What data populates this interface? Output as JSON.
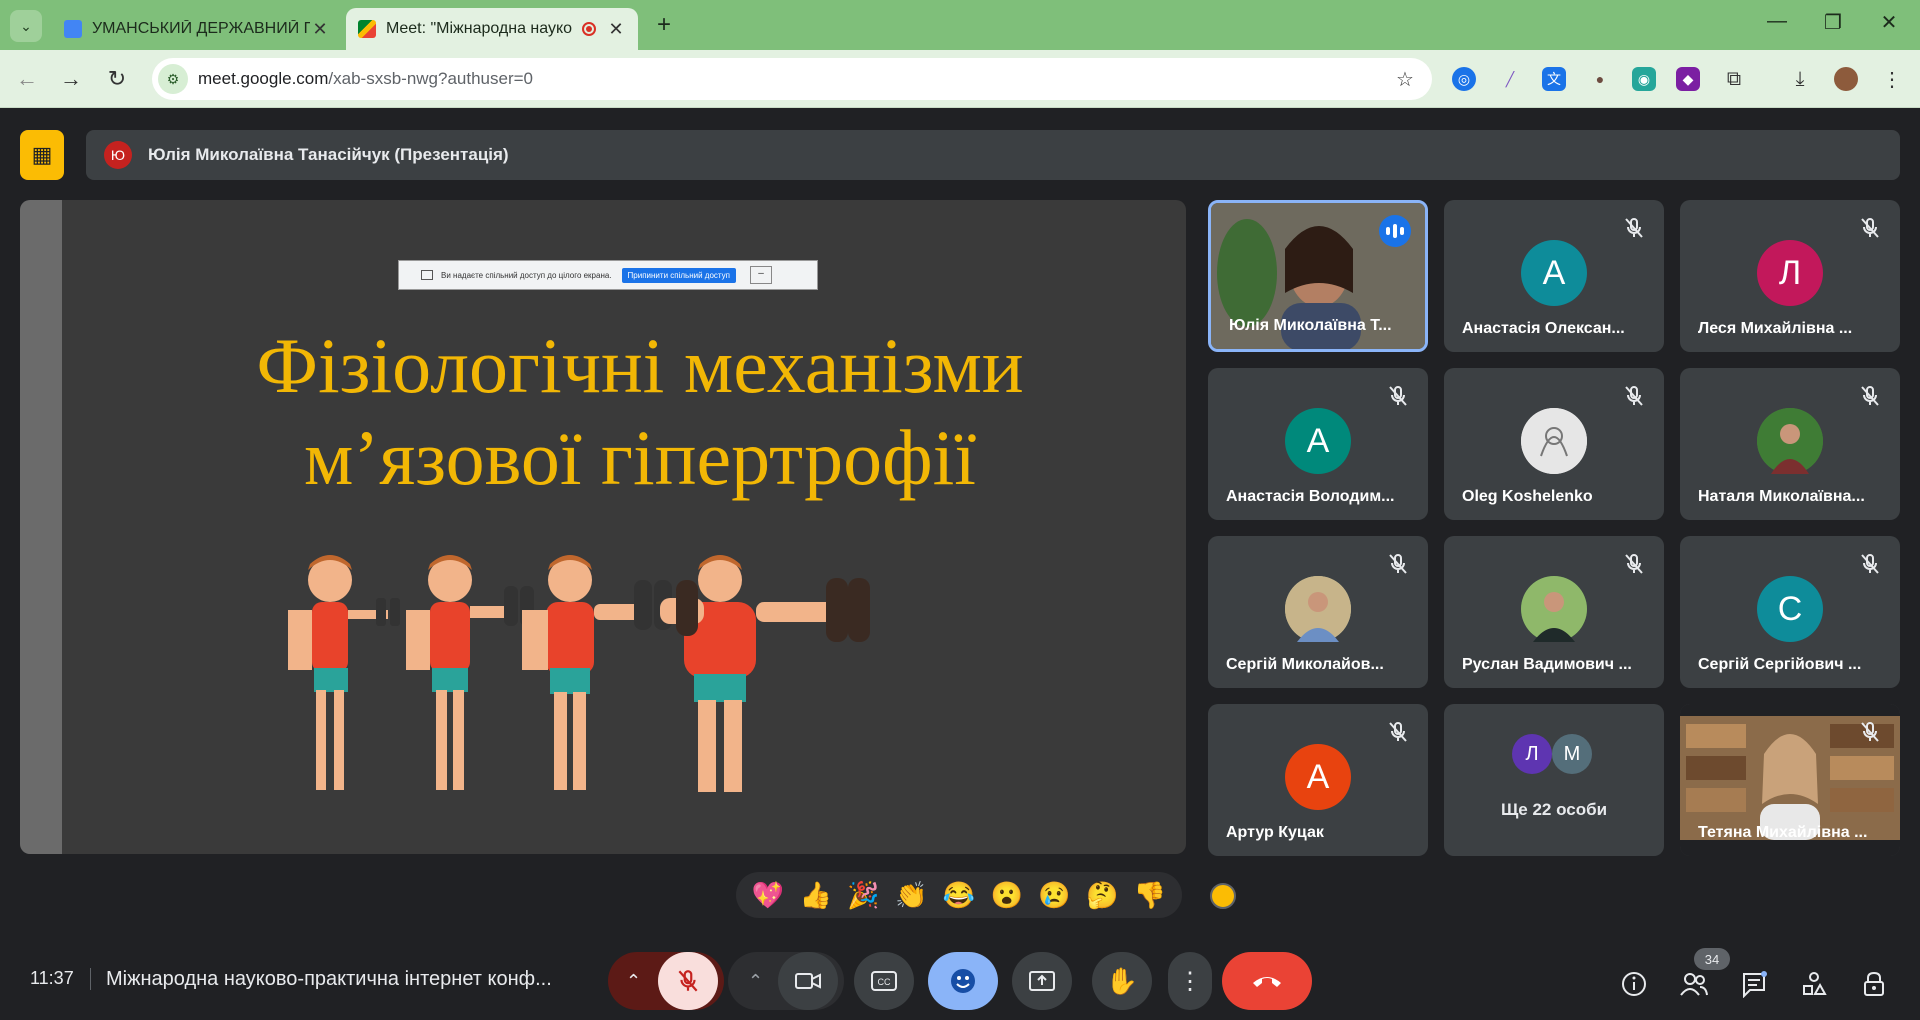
{
  "browser": {
    "tabs": [
      {
        "title": "УМАНСЬКИЙ ДЕРЖАВНИЙ ПЕ",
        "favicon_color": "#4285f4"
      },
      {
        "title": "Meet: \"Міжнародна науко",
        "favicon_color": "#00832d"
      }
    ],
    "url_host": "meet.google.com",
    "url_path": "/xab-sxsb-nwg?authuser=0"
  },
  "meet": {
    "presenter": {
      "initial": "Ю",
      "label": "Юлія Миколаївна Танасійчук (Презентація)"
    },
    "slide": {
      "share_notice": "Ви надаєте спільний доступ до цілого екрана.",
      "stop_sharing": "Припинити спільний доступ",
      "hide": "–",
      "title_line1": "Фізіологічні механізми",
      "title_line2": "м’язової гіпертрофії"
    },
    "participants": [
      {
        "name": "Юлія Миколаївна Т...",
        "type": "video",
        "speaking": true
      },
      {
        "name": "Анастасія Олексан...",
        "initial": "А",
        "color": "#0e8c9a"
      },
      {
        "name": "Леся Михайлівна ...",
        "initial": "Л",
        "color": "#c2185b"
      },
      {
        "name": "Анастасія Володим...",
        "initial": "А",
        "color": "#00897b"
      },
      {
        "name": "Oleg Koshelenko",
        "type": "photo"
      },
      {
        "name": "Наталя Миколаївна...",
        "type": "photo"
      },
      {
        "name": "Сергій Миколайов...",
        "type": "photo"
      },
      {
        "name": "Руслан Вадимович ...",
        "type": "photo"
      },
      {
        "name": "Сергій Сергійович ...",
        "initial": "С",
        "color": "#0e8c9a"
      },
      {
        "name": "Артур Куцак",
        "initial": "А",
        "color": "#e8430f"
      },
      {
        "name": "Ще 22 особи",
        "type": "more",
        "initials": [
          "Л",
          "М"
        ]
      },
      {
        "name": "Тетяна Михайлівна ...",
        "type": "video"
      }
    ],
    "reactions": [
      "💖",
      "👍",
      "🎉",
      "👏",
      "😂",
      "😮",
      "😢",
      "🤔",
      "👎"
    ],
    "time": "11:37",
    "meeting_title": "Міжнародна науково-практична інтернет конф...",
    "participant_count": "34"
  }
}
